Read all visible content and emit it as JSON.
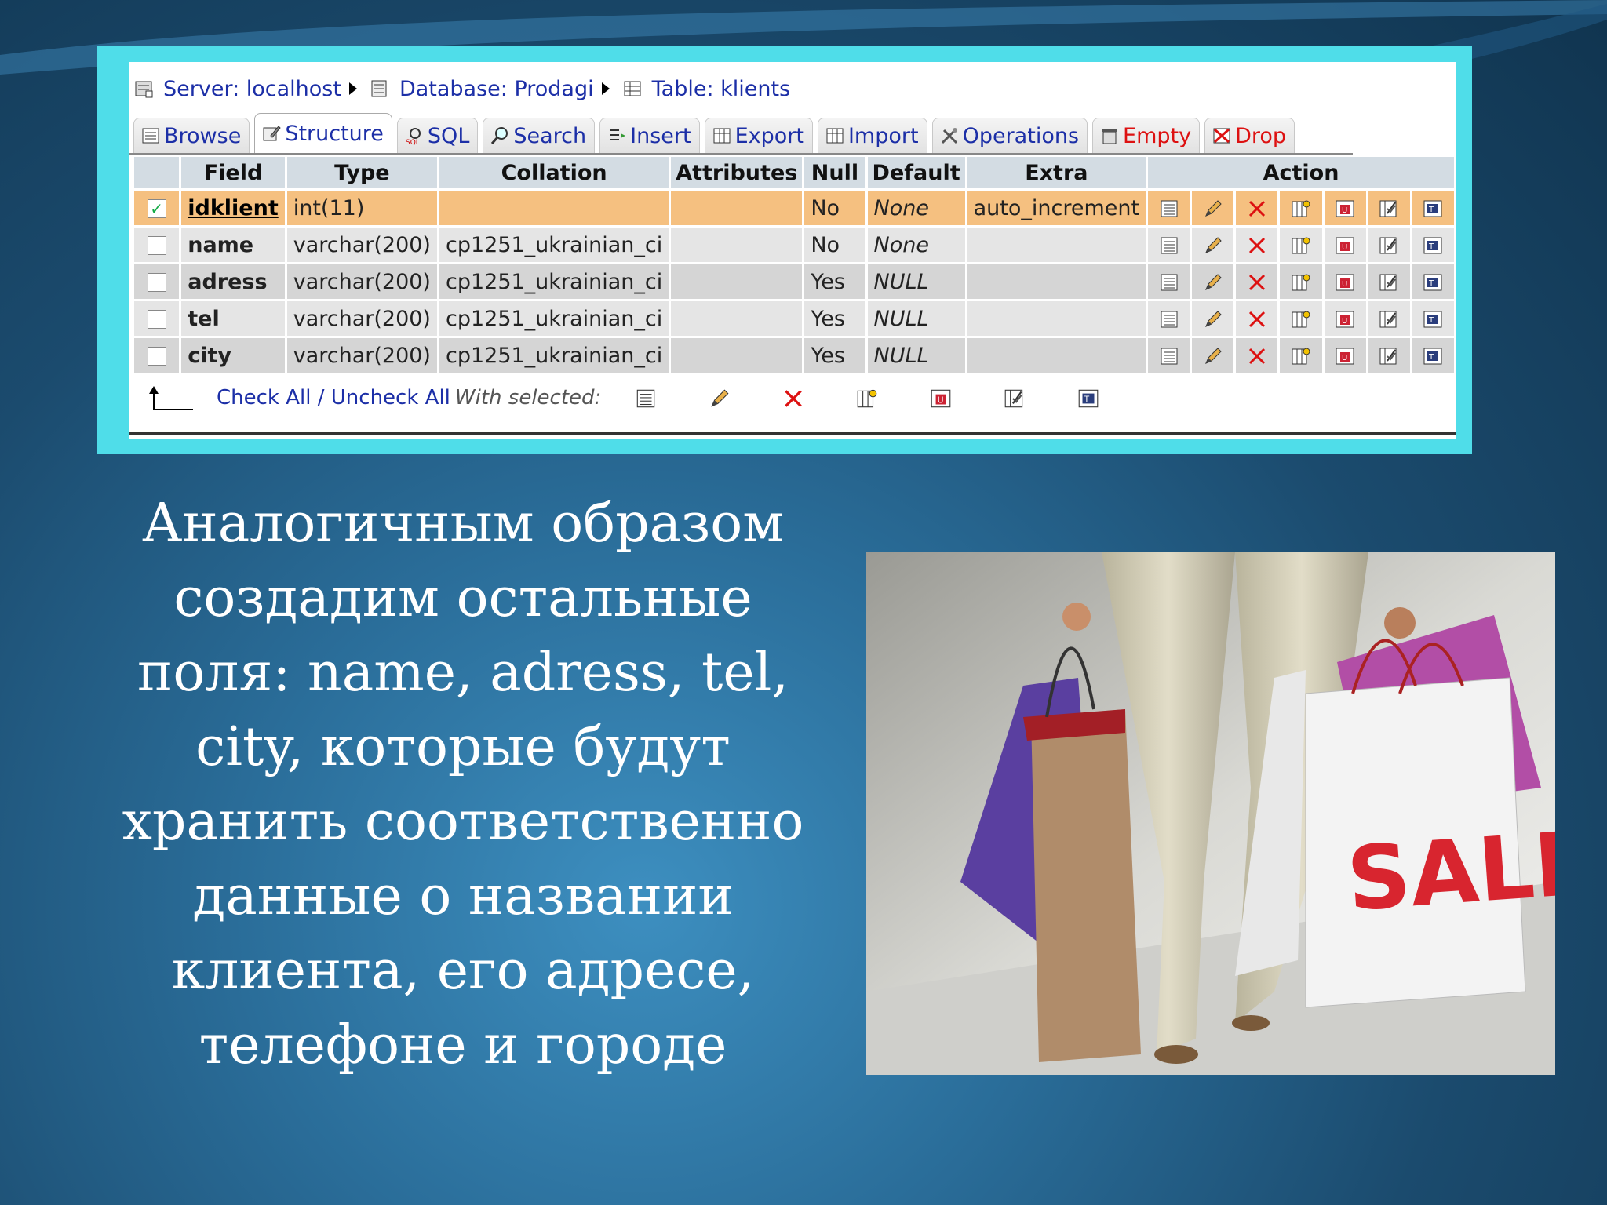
{
  "breadcrumb": {
    "server": "Server: localhost",
    "database": "Database: Prodagi",
    "table": "Table: klients"
  },
  "tabs": [
    {
      "label": "Browse",
      "icon": "browse-icon"
    },
    {
      "label": "Structure",
      "icon": "structure-icon",
      "active": true
    },
    {
      "label": "SQL",
      "icon": "sql-icon"
    },
    {
      "label": "Search",
      "icon": "search-icon"
    },
    {
      "label": "Insert",
      "icon": "insert-icon"
    },
    {
      "label": "Export",
      "icon": "export-icon"
    },
    {
      "label": "Import",
      "icon": "import-icon"
    },
    {
      "label": "Operations",
      "icon": "operations-icon"
    },
    {
      "label": "Empty",
      "icon": "empty-icon"
    },
    {
      "label": "Drop",
      "icon": "drop-icon"
    }
  ],
  "columns": {
    "field": "Field",
    "type": "Type",
    "collation": "Collation",
    "attributes": "Attributes",
    "null": "Null",
    "default": "Default",
    "extra": "Extra",
    "action": "Action"
  },
  "rows": [
    {
      "checked": true,
      "field": "idklient",
      "type": "int(11)",
      "collation": "",
      "attributes": "",
      "null": "No",
      "default": "None",
      "extra": "auto_increment"
    },
    {
      "checked": false,
      "field": "name",
      "type": "varchar(200)",
      "collation": "cp1251_ukrainian_ci",
      "attributes": "",
      "null": "No",
      "default": "None",
      "extra": ""
    },
    {
      "checked": false,
      "field": "adress",
      "type": "varchar(200)",
      "collation": "cp1251_ukrainian_ci",
      "attributes": "",
      "null": "Yes",
      "default": "NULL",
      "extra": ""
    },
    {
      "checked": false,
      "field": "tel",
      "type": "varchar(200)",
      "collation": "cp1251_ukrainian_ci",
      "attributes": "",
      "null": "Yes",
      "default": "NULL",
      "extra": ""
    },
    {
      "checked": false,
      "field": "city",
      "type": "varchar(200)",
      "collation": "cp1251_ukrainian_ci",
      "attributes": "",
      "null": "Yes",
      "default": "NULL",
      "extra": ""
    }
  ],
  "row_actions": [
    "browse-distinct-icon",
    "edit-pencil-icon",
    "delete-x-icon",
    "primary-key-icon",
    "unique-icon",
    "index-icon",
    "fulltext-icon"
  ],
  "footer": {
    "check_all": "Check All / Uncheck All",
    "with_selected": "With selected:"
  },
  "slide": {
    "lines": [
      "Аналогичным образом",
      "создадим остальные",
      "поля: name, adress, tel,",
      "city, которые будут",
      "хранить соответственно",
      "данные о названии",
      "клиента, его адресе,",
      "телефоне и городе"
    ],
    "photo_sign": "SALE"
  },
  "colors": {
    "frame": "#4fdde9",
    "highlight_row": "#f5c080",
    "link": "#1c2fa7",
    "header": "#d3dce3",
    "sale_red": "#d8252f"
  }
}
